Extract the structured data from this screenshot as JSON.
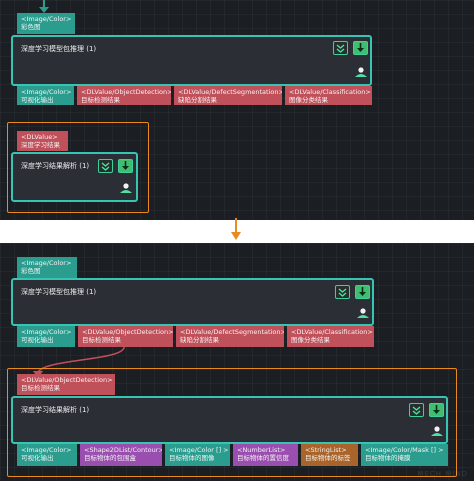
{
  "top": {
    "input_port": {
      "type": "<Image/Color>",
      "name": "彩色图"
    },
    "node": {
      "title": "深度学习模型包推理 (1)"
    },
    "outputs": [
      {
        "type": "<Image/Color>",
        "name": "可视化输出"
      },
      {
        "type": "<DLValue/ObjectDetection>",
        "name": "目标检测结果"
      },
      {
        "type": "<DLValue/DefectSegmentation>",
        "name": "缺陷分割结果"
      },
      {
        "type": "<DLValue/Classification>",
        "name": "图像分类结果"
      }
    ],
    "parse_input": {
      "type": "<DLValue>",
      "name": "深度学习结果"
    },
    "parse_node": {
      "title": "深度学习结果解析 (1)"
    }
  },
  "bottom": {
    "input_port": {
      "type": "<Image/Color>",
      "name": "彩色图"
    },
    "node": {
      "title": "深度学习模型包推理 (1)"
    },
    "outputs": [
      {
        "type": "<Image/Color>",
        "name": "可视化输出"
      },
      {
        "type": "<DLValue/ObjectDetection>",
        "name": "目标检测结果"
      },
      {
        "type": "<DLValue/DefectSegmentation>",
        "name": "缺陷分割结果"
      },
      {
        "type": "<DLValue/Classification>",
        "name": "图像分类结果"
      }
    ],
    "parse_input": {
      "type": "<DLValue/ObjectDetection>",
      "name": "目标检测结果"
    },
    "parse_node": {
      "title": "深度学习结果解析 (1)"
    },
    "parse_outputs": [
      {
        "type": "<Image/Color>",
        "name": "可视化输出"
      },
      {
        "type": "<Shape2DList/Contour>",
        "name": "目标物体的包围盒"
      },
      {
        "type": "<Image/Color [] >",
        "name": "目标物体的图像"
      },
      {
        "type": "<NumberList>",
        "name": "目标物体的置信度"
      },
      {
        "type": "<StringList>",
        "name": "目标物体的标签"
      },
      {
        "type": "<Image/Color/Mask [] >",
        "name": "目标物体的掩膜"
      }
    ]
  },
  "watermark": "MECH MIND",
  "icons": {
    "collapse": "chevron-double-down-icon",
    "run": "download-arrow-icon",
    "visibility": "eye-user-icon",
    "transition": "down-arrow-icon"
  },
  "colors": {
    "node_border": "#37c5b3",
    "teal_port": "#2a9d8f",
    "red_port": "#c0505a",
    "purple_port": "#9a4fb0",
    "brown_port": "#a8642a",
    "frame_highlight": "#e88a1f",
    "canvas": "#1b1e22"
  }
}
